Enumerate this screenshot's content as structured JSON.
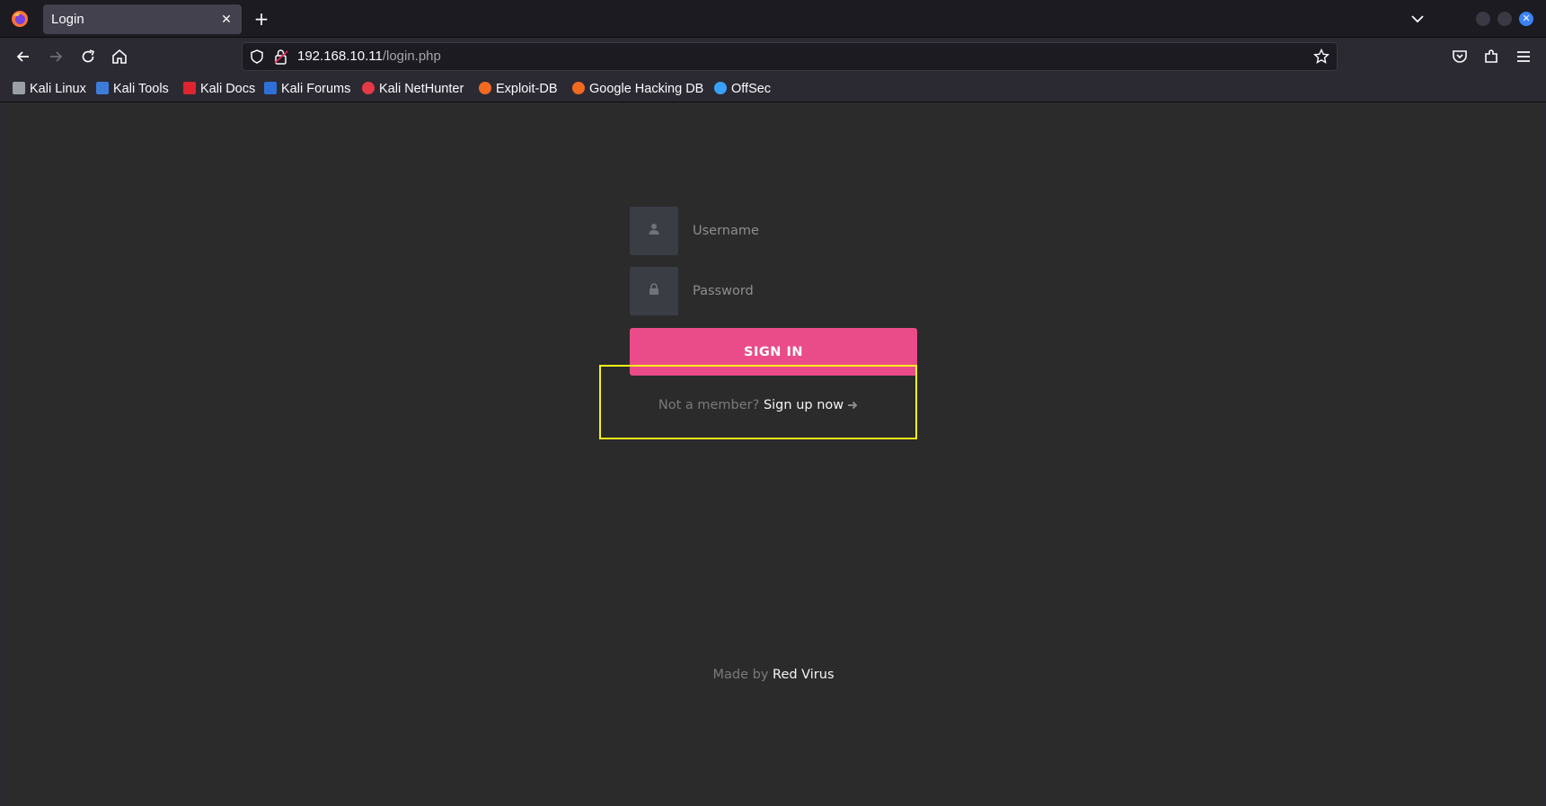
{
  "browser": {
    "tab_title": "Login",
    "url_host": "192.168.10.11",
    "url_path": "/login.php",
    "bookmarks": [
      {
        "label": "Kali Linux",
        "icon": "kali-dragon-icon",
        "color": "#cfd2d6"
      },
      {
        "label": "Kali Tools",
        "icon": "kali-tools-icon",
        "color": "#3d7bd9"
      },
      {
        "label": "Kali Docs",
        "icon": "kali-docs-icon",
        "color": "#e0242f"
      },
      {
        "label": "Kali Forums",
        "icon": "kali-forums-icon",
        "color": "#2f6fd8"
      },
      {
        "label": "Kali NetHunter",
        "icon": "nethunter-icon",
        "color": "#e63946"
      },
      {
        "label": "Exploit-DB",
        "icon": "exploit-db-icon",
        "color": "#f26a21"
      },
      {
        "label": "Google Hacking DB",
        "icon": "ghdb-icon",
        "color": "#f26a21"
      },
      {
        "label": "OffSec",
        "icon": "offsec-icon",
        "color": "#3aa0ff"
      }
    ]
  },
  "login": {
    "username_placeholder": "Username",
    "password_placeholder": "Password",
    "signin_label": "SIGN IN",
    "signup_prompt": "Not a member?",
    "signup_link": "Sign up now",
    "footer_prefix": "Made by",
    "footer_brand": "Red Virus"
  },
  "colors": {
    "accent": "#ea4c89",
    "highlight": "#f5f019",
    "page_bg": "#2b2b2b"
  }
}
